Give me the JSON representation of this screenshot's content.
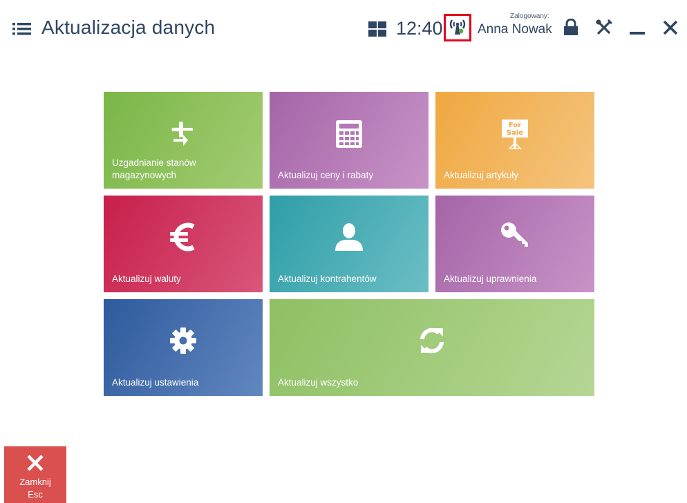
{
  "header": {
    "title": "Aktualizacja danych",
    "clock": "12:40",
    "user_caption": "Zalogowany:",
    "user_name": "Anna Nowak",
    "icons": [
      "menu-icon",
      "tiles-icon",
      "signal-icon",
      "lock-icon",
      "tools-icon",
      "minimize-icon",
      "close-icon"
    ]
  },
  "tiles": [
    {
      "label": "Uzgadnianie stanów magazynowych",
      "icon": "arrows-in-icon",
      "colors": [
        "#7ab648",
        "#a3cc72"
      ]
    },
    {
      "label": "Aktualizuj ceny i rabaty",
      "icon": "calculator-icon",
      "colors": [
        "#a565a8",
        "#c893c7"
      ]
    },
    {
      "label": "Aktualizuj artykuły",
      "icon": "for-sale-sign-icon",
      "icon_text": [
        "For",
        "Sale"
      ],
      "colors": [
        "#f0a840",
        "#f4c47e"
      ]
    },
    {
      "label": "Aktualizuj waluty",
      "icon": "euro-icon",
      "colors": [
        "#c71f4a",
        "#d9567a"
      ]
    },
    {
      "label": "Aktualizuj kontrahentów",
      "icon": "person-icon",
      "colors": [
        "#2f9ea8",
        "#6bbec4"
      ]
    },
    {
      "label": "Aktualizuj uprawnienia",
      "icon": "key-icon",
      "colors": [
        "#a565a8",
        "#c893c7"
      ]
    },
    {
      "label": "Aktualizuj ustawienia",
      "icon": "gear-icon",
      "colors": [
        "#2e5a9c",
        "#6187bf"
      ]
    },
    {
      "label": "Aktualizuj wszystko",
      "icon": "refresh-icon",
      "colors": [
        "#8ec063",
        "#b5d694"
      ]
    }
  ],
  "footer": {
    "close_label": "Zamknij",
    "close_shortcut": "Esc",
    "close_color": "#d9504f"
  }
}
